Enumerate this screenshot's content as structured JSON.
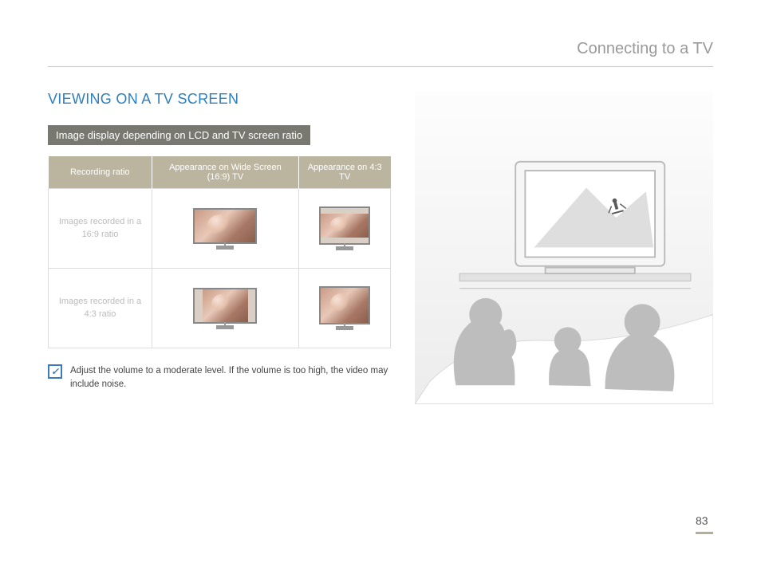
{
  "header": {
    "title": "Connecting to a TV"
  },
  "section": {
    "title": "VIEWING ON A TV SCREEN"
  },
  "subsection": {
    "title": "Image display depending on LCD and TV screen ratio"
  },
  "table": {
    "headers": {
      "col1": "Recording ratio",
      "col2": "Appearance on Wide Screen (16:9) TV",
      "col3": "Appearance on 4:3 TV"
    },
    "rows": {
      "r1_label": "Images recorded in a 16:9 ratio",
      "r2_label": "Images recorded in a 4:3 ratio"
    }
  },
  "note": {
    "text": "Adjust the volume to a moderate level. If the volume is too high, the video may include noise."
  },
  "page_number": "83"
}
